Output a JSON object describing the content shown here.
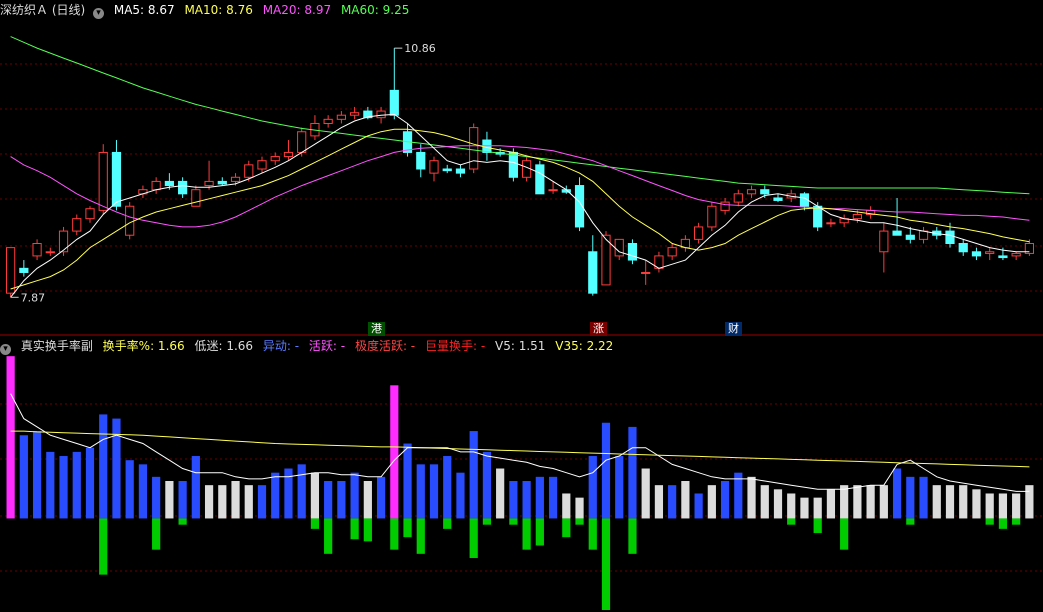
{
  "top_header": {
    "title": "深纺织Ａ (日线)",
    "ma5": "MA5: 8.67",
    "ma10": "MA10: 8.76",
    "ma20": "MA20: 8.97",
    "ma60": "MA60: 9.25"
  },
  "bottom_header": {
    "title": "真实换手率副",
    "turnover": "换手率%: 1.66",
    "low": "低迷: 1.66",
    "abnormal": "异动: -",
    "active": "活跃: -",
    "extreme": "极度活跃: -",
    "huge": "巨量换手: -",
    "v5": "V5: 1.51",
    "v35": "V35: 2.22"
  },
  "events": [
    "港",
    "涨",
    "财"
  ],
  "colors": {
    "up": "#ff3c3c",
    "down": "#54ffff",
    "ma5": "#ffffff",
    "ma10": "#ffff54",
    "ma20": "#ff54ff",
    "ma60": "#54ff54",
    "grid": "#6e0000",
    "bar_blue": "#2a4cff",
    "bar_white": "#dcdcdc",
    "bar_magenta": "#ff2cff",
    "bar_green": "#00cc00"
  },
  "chart_data": {
    "type": "candlestick+bar",
    "price": {
      "ylim": [
        7.6,
        11.2
      ],
      "max_label": "10.86",
      "min_label": "7.87",
      "candles": [
        [
          7.9,
          8.45,
          7.85,
          8.45
        ],
        [
          8.2,
          8.3,
          8.1,
          8.15
        ],
        [
          8.35,
          8.55,
          8.3,
          8.5
        ],
        [
          8.4,
          8.45,
          8.35,
          8.4
        ],
        [
          8.4,
          8.7,
          8.35,
          8.65
        ],
        [
          8.65,
          8.85,
          8.6,
          8.8
        ],
        [
          8.8,
          8.95,
          8.75,
          8.92
        ],
        [
          8.9,
          9.7,
          8.85,
          9.6
        ],
        [
          9.6,
          9.75,
          8.9,
          8.95
        ],
        [
          8.6,
          9.0,
          8.55,
          8.95
        ],
        [
          9.1,
          9.2,
          9.05,
          9.15
        ],
        [
          9.15,
          9.3,
          9.1,
          9.25
        ],
        [
          9.25,
          9.35,
          9.15,
          9.2
        ],
        [
          9.25,
          9.3,
          9.05,
          9.1
        ],
        [
          8.95,
          9.2,
          8.95,
          9.15
        ],
        [
          9.2,
          9.5,
          9.15,
          9.25
        ],
        [
          9.25,
          9.3,
          9.2,
          9.22
        ],
        [
          9.25,
          9.35,
          9.2,
          9.3
        ],
        [
          9.3,
          9.5,
          9.25,
          9.45
        ],
        [
          9.4,
          9.55,
          9.35,
          9.5
        ],
        [
          9.5,
          9.6,
          9.45,
          9.55
        ],
        [
          9.55,
          9.75,
          9.5,
          9.6
        ],
        [
          9.6,
          9.9,
          9.55,
          9.85
        ],
        [
          9.8,
          10.05,
          9.75,
          9.95
        ],
        [
          9.95,
          10.05,
          9.9,
          10.0
        ],
        [
          10.0,
          10.1,
          9.95,
          10.05
        ],
        [
          10.05,
          10.15,
          10.0,
          10.08
        ],
        [
          10.1,
          10.15,
          10.0,
          10.02
        ],
        [
          10.02,
          10.15,
          9.95,
          10.1
        ],
        [
          10.35,
          10.86,
          10.0,
          10.05
        ],
        [
          9.85,
          9.95,
          9.55,
          9.6
        ],
        [
          9.6,
          9.7,
          9.3,
          9.4
        ],
        [
          9.35,
          9.55,
          9.25,
          9.5
        ],
        [
          9.4,
          9.45,
          9.35,
          9.38
        ],
        [
          9.4,
          9.45,
          9.3,
          9.35
        ],
        [
          9.4,
          9.95,
          9.35,
          9.9
        ],
        [
          9.75,
          9.85,
          9.5,
          9.6
        ],
        [
          9.6,
          9.65,
          9.55,
          9.58
        ],
        [
          9.6,
          9.65,
          9.25,
          9.3
        ],
        [
          9.3,
          9.55,
          9.25,
          9.5
        ],
        [
          9.45,
          9.5,
          9.1,
          9.1
        ],
        [
          9.15,
          9.25,
          9.1,
          9.15
        ],
        [
          9.15,
          9.2,
          9.1,
          9.12
        ],
        [
          9.2,
          9.3,
          8.65,
          8.7
        ],
        [
          8.4,
          8.6,
          7.87,
          7.9
        ],
        [
          8.0,
          8.65,
          8.0,
          8.6
        ],
        [
          8.35,
          8.55,
          8.3,
          8.55
        ],
        [
          8.5,
          8.55,
          8.25,
          8.3
        ],
        [
          8.15,
          8.3,
          8.0,
          8.15
        ],
        [
          8.2,
          8.4,
          8.15,
          8.35
        ],
        [
          8.35,
          8.5,
          8.3,
          8.45
        ],
        [
          8.45,
          8.6,
          8.4,
          8.55
        ],
        [
          8.55,
          8.75,
          8.5,
          8.7
        ],
        [
          8.7,
          9.0,
          8.65,
          8.95
        ],
        [
          8.9,
          9.05,
          8.85,
          9.0
        ],
        [
          9.0,
          9.15,
          8.95,
          9.1
        ],
        [
          9.1,
          9.2,
          9.05,
          9.15
        ],
        [
          9.15,
          9.2,
          9.05,
          9.1
        ],
        [
          9.05,
          9.1,
          9.0,
          9.02
        ],
        [
          9.05,
          9.15,
          9.0,
          9.1
        ],
        [
          9.1,
          9.12,
          8.9,
          8.95
        ],
        [
          8.95,
          9.0,
          8.65,
          8.7
        ],
        [
          8.75,
          8.8,
          8.7,
          8.75
        ],
        [
          8.75,
          8.85,
          8.7,
          8.8
        ],
        [
          8.8,
          8.9,
          8.75,
          8.85
        ],
        [
          8.85,
          8.95,
          8.8,
          8.9
        ],
        [
          8.4,
          8.75,
          8.15,
          8.65
        ],
        [
          8.65,
          9.05,
          8.6,
          8.6
        ],
        [
          8.6,
          8.7,
          8.5,
          8.55
        ],
        [
          8.55,
          8.7,
          8.5,
          8.65
        ],
        [
          8.65,
          8.7,
          8.55,
          8.6
        ],
        [
          8.65,
          8.75,
          8.45,
          8.5
        ],
        [
          8.5,
          8.55,
          8.35,
          8.4
        ],
        [
          8.4,
          8.45,
          8.3,
          8.35
        ],
        [
          8.38,
          8.45,
          8.3,
          8.4
        ],
        [
          8.35,
          8.45,
          8.3,
          8.33
        ],
        [
          8.35,
          8.4,
          8.3,
          8.38
        ],
        [
          8.38,
          8.55,
          8.35,
          8.5
        ]
      ],
      "ma5": [
        7.85,
        8.05,
        8.2,
        8.3,
        8.42,
        8.55,
        8.65,
        8.85,
        9.0,
        9.05,
        9.1,
        9.15,
        9.18,
        9.2,
        9.18,
        9.18,
        9.2,
        9.22,
        9.28,
        9.35,
        9.42,
        9.5,
        9.6,
        9.7,
        9.8,
        9.9,
        9.98,
        10.03,
        10.05,
        10.06,
        9.95,
        9.8,
        9.65,
        9.5,
        9.45,
        9.5,
        9.48,
        9.5,
        9.48,
        9.42,
        9.35,
        9.25,
        9.15,
        9.0,
        8.75,
        8.55,
        8.4,
        8.35,
        8.3,
        8.2,
        8.25,
        8.3,
        8.45,
        8.6,
        8.72,
        8.88,
        9.0,
        9.08,
        9.1,
        9.07,
        9.05,
        8.95,
        8.85,
        8.8,
        8.78,
        8.75,
        8.75,
        8.72,
        8.68,
        8.65,
        8.62,
        8.6,
        8.55,
        8.5,
        8.45,
        8.42,
        8.4,
        8.4
      ],
      "ma10": [
        7.95,
        8.0,
        8.05,
        8.1,
        8.18,
        8.3,
        8.45,
        8.55,
        8.65,
        8.75,
        8.82,
        8.88,
        8.92,
        8.96,
        9.0,
        9.04,
        9.08,
        9.12,
        9.16,
        9.2,
        9.26,
        9.32,
        9.4,
        9.48,
        9.56,
        9.64,
        9.72,
        9.8,
        9.85,
        9.88,
        9.88,
        9.86,
        9.84,
        9.8,
        9.75,
        9.7,
        9.66,
        9.63,
        9.6,
        9.56,
        9.52,
        9.48,
        9.42,
        9.35,
        9.25,
        9.1,
        8.95,
        8.82,
        8.72,
        8.62,
        8.5,
        8.45,
        8.42,
        8.45,
        8.5,
        8.6,
        8.68,
        8.76,
        8.84,
        8.9,
        8.92,
        8.93,
        8.92,
        8.9,
        8.88,
        8.86,
        8.84,
        8.82,
        8.78,
        8.76,
        8.73,
        8.7,
        8.68,
        8.65,
        8.62,
        8.58,
        8.55,
        8.52
      ],
      "ma20": [
        9.55,
        9.45,
        9.38,
        9.3,
        9.2,
        9.1,
        9.02,
        8.95,
        8.88,
        8.82,
        8.78,
        8.75,
        8.72,
        8.7,
        8.7,
        8.72,
        8.76,
        8.82,
        8.9,
        8.98,
        9.06,
        9.13,
        9.2,
        9.26,
        9.32,
        9.38,
        9.44,
        9.5,
        9.55,
        9.6,
        9.63,
        9.65,
        9.66,
        9.67,
        9.68,
        9.68,
        9.68,
        9.68,
        9.67,
        9.66,
        9.64,
        9.62,
        9.58,
        9.54,
        9.5,
        9.44,
        9.38,
        9.32,
        9.26,
        9.2,
        9.14,
        9.08,
        9.03,
        9.0,
        8.97,
        8.96,
        8.96,
        8.96,
        8.96,
        8.95,
        8.94,
        8.93,
        8.92,
        8.92,
        8.91,
        8.9,
        8.89,
        8.88,
        8.88,
        8.87,
        8.86,
        8.85,
        8.84,
        8.84,
        8.83,
        8.82,
        8.8,
        8.78
      ],
      "ma60": [
        11.0,
        10.93,
        10.86,
        10.8,
        10.74,
        10.68,
        10.62,
        10.56,
        10.5,
        10.44,
        10.38,
        10.33,
        10.28,
        10.23,
        10.18,
        10.14,
        10.1,
        10.06,
        10.02,
        9.98,
        9.95,
        9.92,
        9.89,
        9.87,
        9.85,
        9.83,
        9.81,
        9.79,
        9.77,
        9.75,
        9.73,
        9.71,
        9.69,
        9.67,
        9.65,
        9.63,
        9.61,
        9.59,
        9.57,
        9.55,
        9.53,
        9.51,
        9.49,
        9.47,
        9.45,
        9.43,
        9.41,
        9.39,
        9.37,
        9.35,
        9.33,
        9.31,
        9.29,
        9.27,
        9.25,
        9.23,
        9.22,
        9.21,
        9.2,
        9.19,
        9.18,
        9.17,
        9.17,
        9.17,
        9.17,
        9.17,
        9.17,
        9.17,
        9.17,
        9.17,
        9.17,
        9.16,
        9.15,
        9.14,
        9.13,
        9.12,
        9.11,
        9.1
      ]
    },
    "turnover": {
      "ylim": [
        -2.2,
        4.0
      ],
      "bars": [
        3.9,
        2.0,
        2.1,
        1.6,
        1.5,
        1.6,
        1.7,
        2.5,
        2.4,
        1.4,
        1.3,
        1.0,
        0.9,
        0.9,
        1.5,
        0.8,
        0.8,
        0.9,
        0.8,
        0.8,
        1.1,
        1.2,
        1.3,
        1.1,
        0.9,
        0.9,
        1.1,
        0.9,
        1.0,
        3.2,
        1.8,
        1.3,
        1.3,
        1.5,
        1.1,
        2.1,
        1.6,
        1.2,
        0.9,
        0.9,
        1.0,
        1.0,
        0.6,
        0.5,
        1.5,
        2.3,
        1.5,
        2.2,
        1.2,
        0.8,
        0.8,
        0.9,
        0.6,
        0.8,
        0.9,
        1.1,
        1.0,
        0.8,
        0.7,
        0.6,
        0.5,
        0.5,
        0.7,
        0.8,
        0.8,
        0.8,
        0.8,
        1.2,
        1.0,
        1.0,
        0.8,
        0.8,
        0.8,
        0.7,
        0.6,
        0.6,
        0.6,
        0.8
      ],
      "types": [
        "m",
        "b",
        "b",
        "b",
        "b",
        "b",
        "b",
        "b",
        "b",
        "b",
        "b",
        "b",
        "w",
        "b",
        "b",
        "w",
        "w",
        "w",
        "w",
        "b",
        "b",
        "b",
        "b",
        "w",
        "b",
        "b",
        "b",
        "w",
        "b",
        "m",
        "b",
        "b",
        "b",
        "b",
        "b",
        "b",
        "b",
        "w",
        "b",
        "b",
        "b",
        "b",
        "w",
        "w",
        "b",
        "b",
        "b",
        "b",
        "w",
        "w",
        "b",
        "w",
        "b",
        "w",
        "b",
        "b",
        "w",
        "w",
        "w",
        "w",
        "w",
        "w",
        "w",
        "w",
        "w",
        "w",
        "w",
        "b",
        "b",
        "b",
        "w",
        "w",
        "w",
        "w",
        "w",
        "w",
        "w",
        "w"
      ],
      "neg": [
        0,
        0,
        0,
        0,
        0,
        0,
        0,
        -1.35,
        0,
        0,
        0,
        -0.75,
        0,
        -0.15,
        0,
        0,
        0,
        0,
        0,
        0,
        0,
        0,
        0,
        -0.25,
        -0.85,
        0,
        -0.5,
        -0.55,
        0,
        -0.75,
        -0.45,
        -0.85,
        0,
        -0.25,
        0,
        -0.95,
        -0.15,
        0,
        -0.15,
        -0.75,
        -0.65,
        0,
        -0.45,
        -0.15,
        -0.75,
        -2.2,
        0,
        -0.85,
        0,
        0,
        0,
        0,
        0,
        0,
        0,
        0,
        0,
        0,
        0,
        -0.15,
        0,
        -0.35,
        0,
        -0.75,
        0,
        0,
        0,
        0,
        -0.15,
        0,
        0,
        0,
        0,
        0,
        -0.15,
        -0.25,
        -0.15,
        0
      ],
      "v5": [
        3.0,
        2.4,
        2.2,
        2.0,
        1.9,
        1.8,
        1.7,
        1.9,
        2.0,
        1.9,
        1.8,
        1.6,
        1.4,
        1.2,
        1.1,
        1.1,
        1.1,
        1.0,
        0.95,
        0.95,
        1.0,
        1.0,
        1.05,
        1.1,
        1.1,
        1.05,
        1.05,
        1.0,
        1.0,
        1.4,
        1.7,
        1.7,
        1.7,
        1.7,
        1.6,
        1.6,
        1.5,
        1.45,
        1.4,
        1.35,
        1.25,
        1.2,
        1.1,
        1.0,
        1.1,
        1.4,
        1.5,
        1.7,
        1.7,
        1.5,
        1.3,
        1.2,
        1.1,
        1.0,
        0.95,
        0.95,
        0.95,
        0.9,
        0.85,
        0.8,
        0.75,
        0.7,
        0.7,
        0.7,
        0.75,
        0.8,
        0.8,
        1.3,
        1.4,
        1.2,
        1.0,
        0.9,
        0.85,
        0.8,
        0.75,
        0.7,
        0.65,
        0.65
      ],
      "v35": [
        2.1,
        2.1,
        2.08,
        2.07,
        2.06,
        2.05,
        2.04,
        2.03,
        2.02,
        2.01,
        2.0,
        1.98,
        1.96,
        1.94,
        1.92,
        1.9,
        1.88,
        1.86,
        1.84,
        1.82,
        1.8,
        1.79,
        1.78,
        1.77,
        1.76,
        1.75,
        1.74,
        1.73,
        1.72,
        1.72,
        1.71,
        1.7,
        1.69,
        1.68,
        1.67,
        1.66,
        1.65,
        1.64,
        1.63,
        1.62,
        1.61,
        1.6,
        1.59,
        1.58,
        1.57,
        1.56,
        1.55,
        1.54,
        1.53,
        1.52,
        1.51,
        1.5,
        1.49,
        1.48,
        1.47,
        1.46,
        1.45,
        1.44,
        1.43,
        1.42,
        1.41,
        1.4,
        1.39,
        1.38,
        1.37,
        1.36,
        1.35,
        1.34,
        1.33,
        1.32,
        1.31,
        1.3,
        1.29,
        1.28,
        1.27,
        1.26,
        1.25,
        1.24
      ]
    }
  }
}
